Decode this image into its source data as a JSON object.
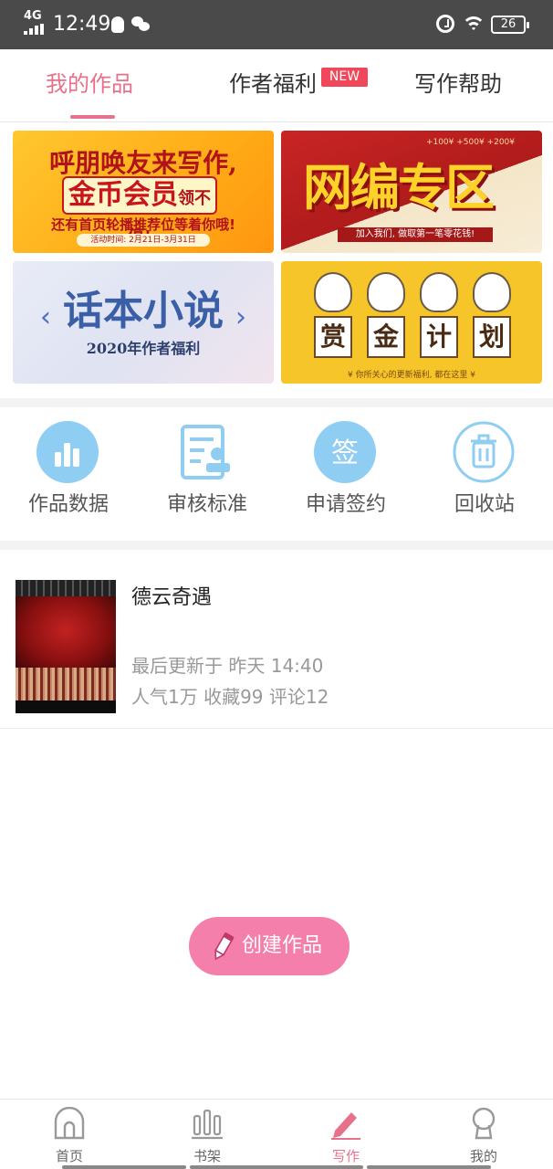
{
  "status_bar": {
    "network": "4G",
    "time": "12:49",
    "battery": "26"
  },
  "tabs": [
    {
      "label": "我的作品",
      "active": true
    },
    {
      "label": "作者福利",
      "badge": "NEW"
    },
    {
      "label": "写作帮助"
    }
  ],
  "banners": {
    "b1": {
      "line1": "呼朋唤友来写作,",
      "line2": "金币会员",
      "line2_suffix": "领不停!",
      "line3": "还有首页轮播推荐位等着你哦!",
      "line4": "活动时间: 2月21日-3月31日"
    },
    "b2": {
      "title": "网编专区",
      "sub": "加入我们, 做取第一笔零花钱!",
      "amounts": "+100¥  +500¥  +200¥"
    },
    "b3": {
      "title": "话本小说",
      "sub": "2020年作者福利"
    },
    "b4": {
      "chars": [
        "赏",
        "金",
        "计",
        "划"
      ],
      "sub": "¥ 你所关心的更新福利, 都在这里 ¥"
    }
  },
  "quick_actions": [
    {
      "label": "作品数据",
      "icon": "bar-chart-icon"
    },
    {
      "label": "审核标准",
      "icon": "review-document-icon"
    },
    {
      "label": "申请签约",
      "icon": "sign-icon"
    },
    {
      "label": "回收站",
      "icon": "trash-icon"
    }
  ],
  "works": [
    {
      "title": "德云奇遇",
      "updated": "最后更新于 昨天 14:40",
      "stats": "人气1万  收藏99  评论12"
    }
  ],
  "create_button": {
    "label": "创建作品"
  },
  "bottom_nav": [
    {
      "label": "首页",
      "icon": "home-icon"
    },
    {
      "label": "书架",
      "icon": "bookshelf-icon"
    },
    {
      "label": "写作",
      "icon": "pencil-icon",
      "active": true
    },
    {
      "label": "我的",
      "icon": "profile-icon"
    }
  ],
  "colors": {
    "accent": "#e7718b",
    "create_button": "#f57fab",
    "icon_blue": "#7fc4ef",
    "badge": "#f0485a"
  }
}
